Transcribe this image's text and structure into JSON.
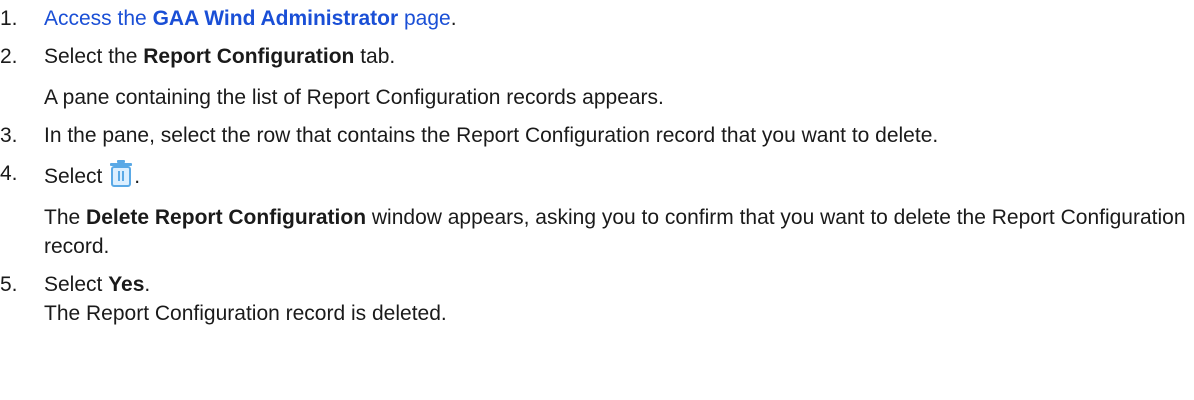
{
  "steps": [
    {
      "num": "1.",
      "pre": "",
      "link_prefix": "Access the ",
      "link_bold": "GAA Wind Administrator",
      "link_suffix": " page",
      "post": "."
    },
    {
      "num": "2.",
      "pre": "Select the ",
      "bold": "Report Configuration",
      "post": " tab.",
      "result": "A pane containing the list of Report Configuration records appears."
    },
    {
      "num": "3.",
      "text": "In the pane, select the row that contains the Report Configuration record that you want to delete."
    },
    {
      "num": "4.",
      "pre": "Select ",
      "icon": "trash-icon",
      "post": ".",
      "result_bold": "Delete Report Configuration",
      "result_pre": "The ",
      "result_post": " window appears, asking you to confirm that you want to delete the Report Configuration record."
    },
    {
      "num": "5.",
      "pre": "Select ",
      "bold": "Yes",
      "post": ".",
      "result": "The Report Configuration record is deleted."
    }
  ],
  "colors": {
    "link": "#1a4fd6",
    "icon": "#5aa9e6"
  }
}
